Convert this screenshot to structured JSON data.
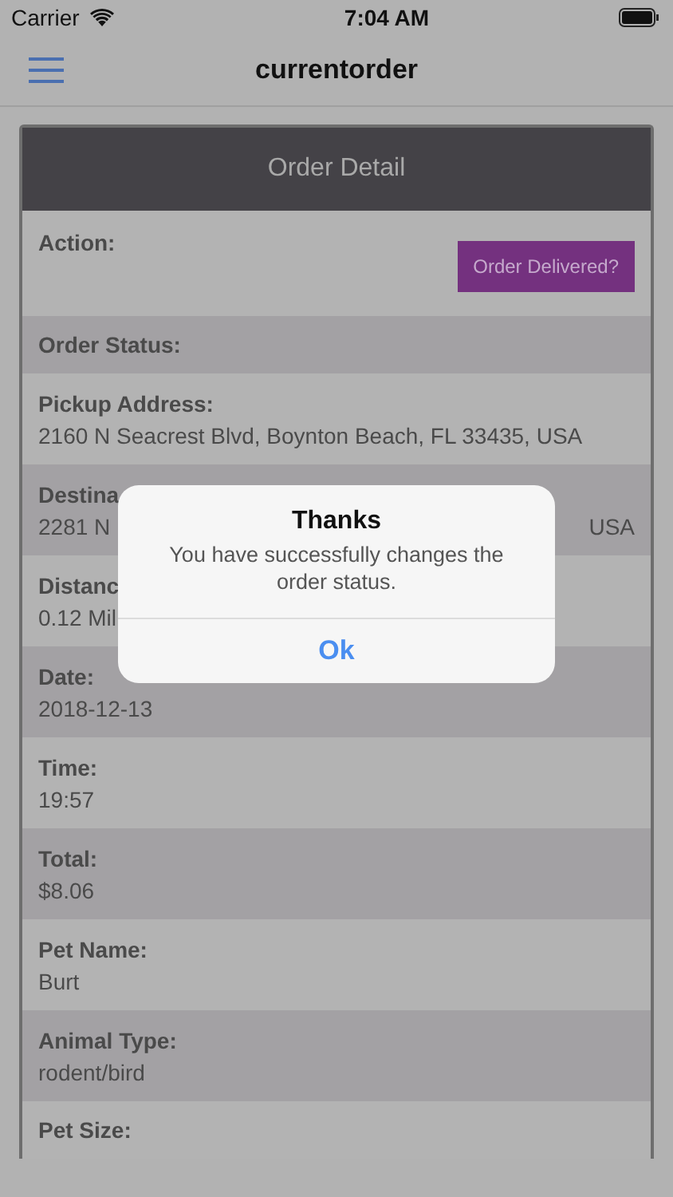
{
  "status_bar": {
    "carrier": "Carrier",
    "time": "7:04 AM"
  },
  "nav": {
    "title": "currentorder"
  },
  "card": {
    "title": "Order Detail",
    "rows": [
      {
        "kind": "action",
        "label": "Action:",
        "button": "Order Delivered?"
      },
      {
        "kind": "plain",
        "label": "Order Status:"
      },
      {
        "kind": "field",
        "label": "Pickup Address:",
        "value": "2160 N Seacrest Blvd, Boynton Beach, FL 33435, USA"
      },
      {
        "kind": "split",
        "label": "Destina",
        "value": "2281 N",
        "value_right": "USA"
      },
      {
        "kind": "field",
        "label": "Distanc",
        "value": "0.12 Mil"
      },
      {
        "kind": "field",
        "label": "Date:",
        "value": "2018-12-13"
      },
      {
        "kind": "field",
        "label": "Time:",
        "value": "19:57"
      },
      {
        "kind": "field",
        "label": "Total:",
        "value": "$8.06"
      },
      {
        "kind": "field",
        "label": "Pet Name:",
        "value": "Burt"
      },
      {
        "kind": "field",
        "label": "Animal Type:",
        "value": "rodent/bird"
      },
      {
        "kind": "plain",
        "label": "Pet Size:"
      }
    ]
  },
  "alert": {
    "title": "Thanks",
    "message": "You have successfully changes the order status.",
    "button": "Ok"
  }
}
